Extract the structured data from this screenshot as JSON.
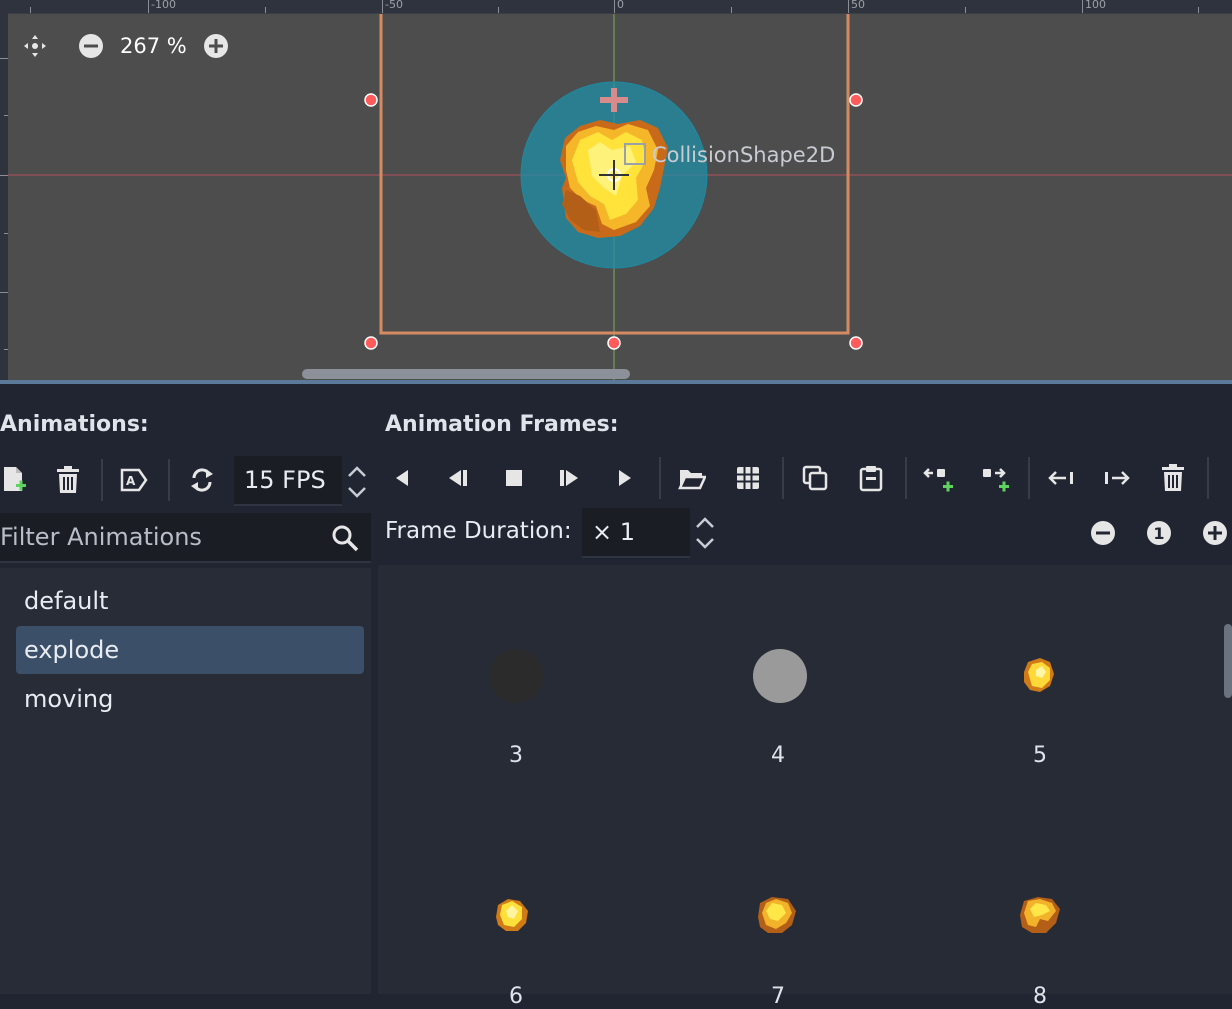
{
  "viewport": {
    "zoom": {
      "value_text": "267 %",
      "zoom_out_icon": "minus-circle-icon",
      "zoom_in_icon": "plus-circle-icon",
      "reset_icon": "center-view-icon"
    },
    "ruler_labels": [
      "-100",
      "-50",
      "0",
      "50",
      "100"
    ],
    "node_label": "CollisionShape2D",
    "colors": {
      "rect": "#d58a62",
      "circle": "#1f8fa6",
      "handle": "#ff5b5b",
      "x_axis": "#c0505a",
      "y_axis": "#6fae4f"
    }
  },
  "animations_panel": {
    "heading": "Animations:",
    "toolbar": {
      "add_icon": "new-animation-icon",
      "delete_icon": "trash-icon",
      "rename_icon": "rename-icon",
      "loop_icon": "loop-icon",
      "fps_value": "15 FPS"
    },
    "filter": {
      "placeholder": "Filter Animations",
      "value": "",
      "icon": "search-icon"
    },
    "items": [
      {
        "label": "default",
        "selected": false
      },
      {
        "label": "explode",
        "selected": true
      },
      {
        "label": "moving",
        "selected": false
      }
    ]
  },
  "frames_panel": {
    "heading": "Animation Frames:",
    "toolbar_icons": [
      "play-backwards-icon",
      "play-backwards-from-end-icon",
      "stop-icon",
      "play-from-start-icon",
      "play-icon",
      "open-folder-icon",
      "grid-icon",
      "copy-icon",
      "paste-icon",
      "insert-before-icon",
      "insert-after-icon",
      "move-left-icon",
      "move-right-icon",
      "delete-frame-icon"
    ],
    "duration": {
      "label": "Frame Duration:",
      "value": "× 1"
    },
    "zoom_icons": [
      "zoom-out-icon",
      "zoom-reset-icon",
      "zoom-in-icon"
    ],
    "zoom_reset_text": "1",
    "frames": [
      {
        "number": "3",
        "kind": "dark"
      },
      {
        "number": "4",
        "kind": "grey"
      },
      {
        "number": "5",
        "kind": "fire-small"
      },
      {
        "number": "6",
        "kind": "fire-round"
      },
      {
        "number": "7",
        "kind": "fire-mid"
      },
      {
        "number": "8",
        "kind": "fire-swirl"
      }
    ]
  }
}
